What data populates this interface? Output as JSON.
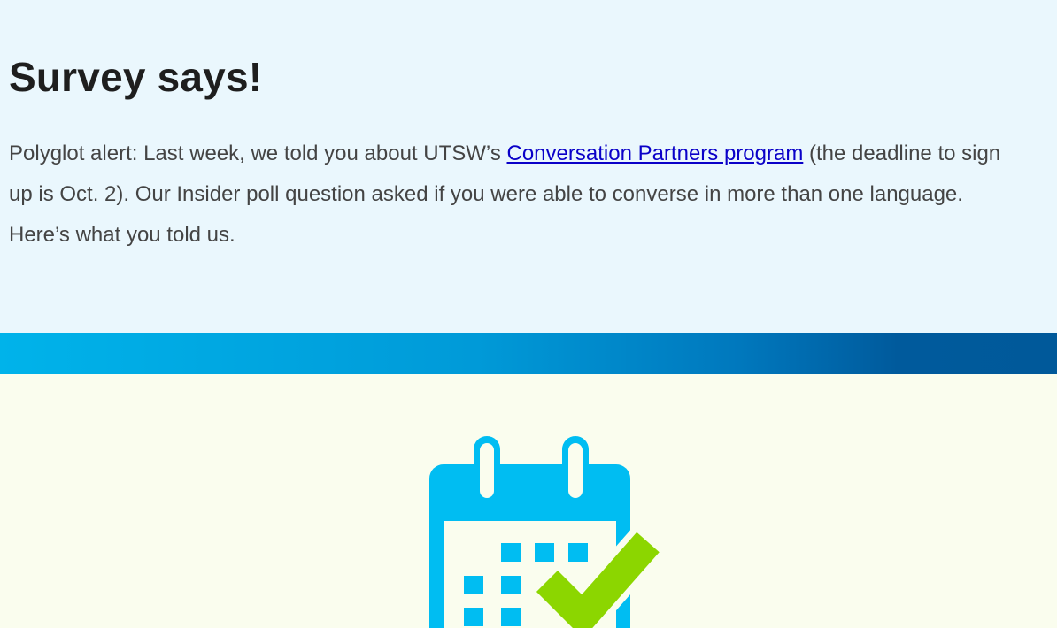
{
  "survey": {
    "title": "Survey says!",
    "text_before_link": "Polyglot alert: Last week, we told you about UTSW’s ",
    "link_text": "Conversation Partners program",
    "text_after_link": " (the deadline to sign up is Oct. 2). Our Insider poll question asked if you were able to converse in more than one language. Here’s what you told us."
  },
  "colors": {
    "survey_bg": "#eaf7fd",
    "band_start": "#00b3ea",
    "band_end": "#00599a",
    "icon_section_bg": "#fafdee",
    "calendar_blue": "#00bdf2",
    "checkmark_green": "#8cd600",
    "link": "#0a00c8"
  },
  "icons": {
    "main": "calendar-check-icon"
  }
}
